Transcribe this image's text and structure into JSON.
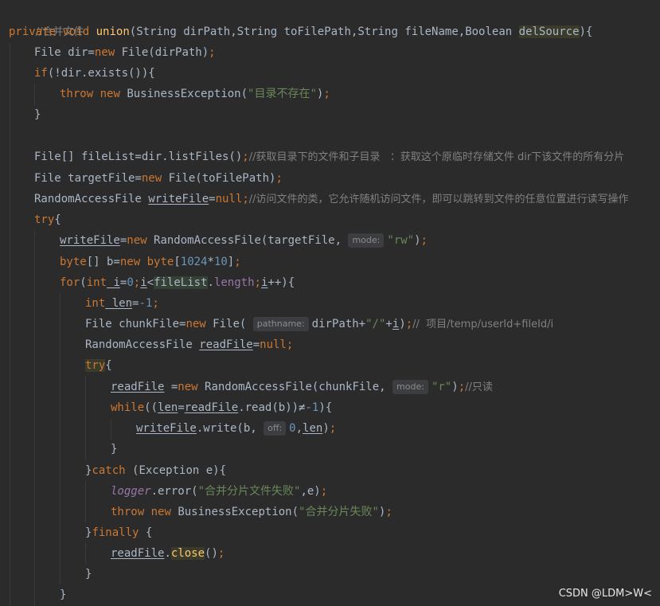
{
  "code": {
    "l01": {
      "comment": "//合并文件"
    },
    "l02": {
      "kw1": "private",
      "kw2": "void",
      "method": "union",
      "params": "(String dirPath,String toFilePath,String fileName,Boolean ",
      "param_hl": "delSource",
      "end": "){"
    },
    "l03": {
      "a": "File dir=",
      "kw": "new",
      "b": " File(dirPath)",
      "semi": ";"
    },
    "l04": {
      "kw": "if",
      "rest": "(!dir.exists()){"
    },
    "l05": {
      "kw1": "throw",
      "kw2": "new",
      "a": " BusinessException(",
      "str": "\"目录不存在\"",
      "b": ")",
      "semi": ";"
    },
    "l06": {
      "text": "}"
    },
    "l08": {
      "a": "File[] fileList=dir.listFiles()",
      "semi": ";",
      "comment": "//获取目录下的文件和子目录   ：获取这个原临时存储文件 dir下该文件的所有分片"
    },
    "l09": {
      "a": "File targetFile=",
      "kw": "new",
      "b": " File(toFilePath)",
      "semi": ";"
    },
    "l10": {
      "a": "RandomAccessFile ",
      "var": "writeFile",
      "eq": "=",
      "kw": "null",
      "semi": ";",
      "comment": "//访问文件的类，它允许随机访问文件，即可以跳转到文件的任意位置进行读写操作"
    },
    "l11": {
      "kw": "try",
      "rest": "{"
    },
    "l12": {
      "var": "writeFile",
      "a": "=",
      "kw": "new",
      "b": " RandomAccessFile(targetFile,",
      "hint": "mode:",
      "str": "\"rw\"",
      "c": ")",
      "semi": ";"
    },
    "l13": {
      "kw1": "byte",
      "a": "[] b=",
      "kw2": "new",
      "kw3": " byte",
      "b": "[",
      "n1": "1024",
      "mul": "*",
      "n2": "10",
      "c": "]",
      "semi": ";"
    },
    "l14": {
      "kw1": "for",
      "a": "(",
      "kw2": "int",
      "var1": " i",
      "b": "=",
      "n0": "0",
      "semi1": ";",
      "var2": "i",
      "lt": "<",
      "hlvar": "fileList",
      "dot": ".",
      "field": "length",
      "semi2": ";",
      "var3": "i",
      "pp": "++){"
    },
    "l15": {
      "kw": "int",
      "var": " len",
      "a": "=",
      "n": "-1",
      "semi": ";"
    },
    "l16": {
      "a": "File chunkFile=",
      "kw": "new",
      "b": " File(",
      "hint": "pathname:",
      "c": "dirPath+",
      "str": "\"/\"",
      "plus": "+",
      "var": "i",
      "d": ")",
      "semi": ";",
      "comment": "//  项目/temp/userId+fileId/i"
    },
    "l17": {
      "a": "RandomAccessFile ",
      "var": "readFile",
      "eq": "=",
      "kw": "null",
      "semi": ";"
    },
    "l18": {
      "kw": "try",
      "rest": "{"
    },
    "l19": {
      "var": "readFile",
      "a": " =",
      "kw": "new",
      "b": " RandomAccessFile(chunkFile,",
      "hint": "mode:",
      "str": "\"r\"",
      "c": ")",
      "semi": ";",
      "comment": "//只读"
    },
    "l20": {
      "kw": "while",
      "a": "((",
      "var1": "len",
      "eq": "=",
      "var2": "readFile",
      "b": ".read(b))",
      "ne": "≠",
      "n": "-1",
      "c": "){"
    },
    "l21": {
      "var": "writeFile",
      "a": ".write(b,",
      "hint": "off:",
      "n": "0",
      "comma": ",",
      "var2": "len",
      "b": ")",
      "semi": ";"
    },
    "l22": {
      "text": "}"
    },
    "l23": {
      "a": "}",
      "kw": "catch",
      "b": " (Exception e){"
    },
    "l24": {
      "field": "logger",
      "a": ".error(",
      "str": "\"合并分片文件失败\"",
      "b": ",e)",
      "semi": ";"
    },
    "l25": {
      "kw1": "throw",
      "kw2": "new",
      "a": " BusinessException(",
      "str": "\"合并分片失败\"",
      "b": ")",
      "semi": ";"
    },
    "l26": {
      "a": "}",
      "kw": "finally",
      "b": " {"
    },
    "l27": {
      "var": "readFile",
      "dot": ".",
      "method": "close",
      "a": "()",
      "semi": ";"
    },
    "l28": {
      "text": "}"
    },
    "l29": {
      "text": "}"
    }
  },
  "watermark": "CSDN @LDM>W<",
  "colors": {
    "background": "#2b2b2b",
    "keyword": "#cc7832",
    "text": "#a9b7c6",
    "string": "#6a8759",
    "number": "#6897bb",
    "comment": "#808080",
    "method": "#ffc66d",
    "field": "#9876aa"
  }
}
